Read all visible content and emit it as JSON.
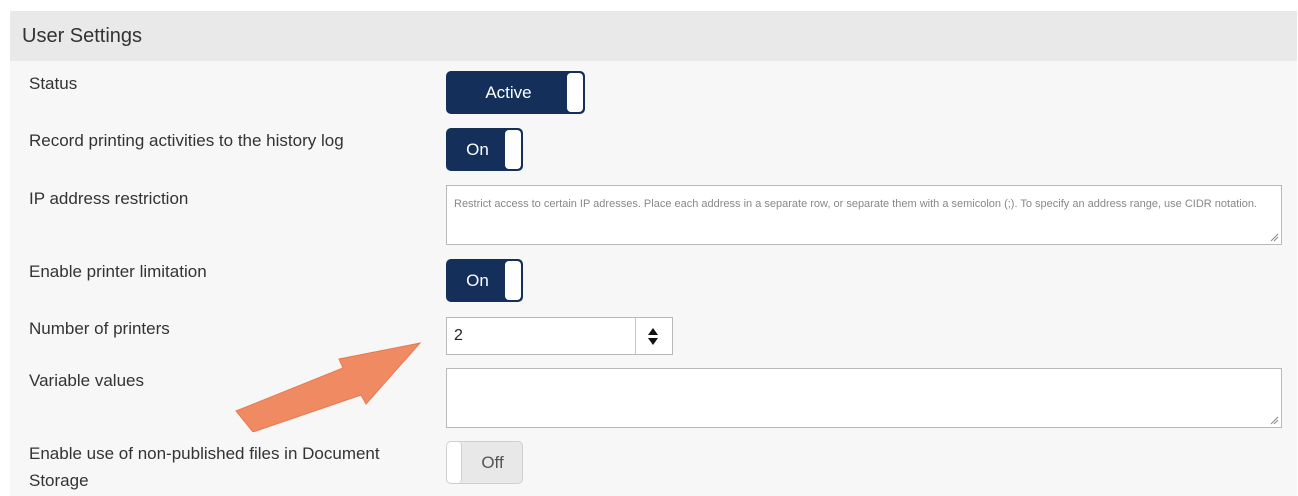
{
  "panel": {
    "title": "User Settings"
  },
  "rows": {
    "status": {
      "label": "Status",
      "toggle_text": "Active"
    },
    "record_history": {
      "label": "Record printing activities to the history log",
      "toggle_text": "On"
    },
    "ip_restriction": {
      "label": "IP address restriction",
      "placeholder": "Restrict access to certain IP adresses. Place each address in a separate row, or separate them with a semicolon (;). To specify an address range, use CIDR notation."
    },
    "printer_limitation": {
      "label": "Enable printer limitation",
      "toggle_text": "On"
    },
    "num_printers": {
      "label": "Number of printers",
      "value": "2"
    },
    "variable_values": {
      "label": "Variable values",
      "value": ""
    },
    "non_published": {
      "label_line1": "Enable use of non-published files in Document",
      "label_line2": "Storage",
      "toggle_text": "Off"
    }
  },
  "colors": {
    "accent": "#14305a",
    "annotation_arrow": "#f08a62",
    "panel_bg": "#f7f7f7",
    "header_bg": "#e9e9e9"
  }
}
